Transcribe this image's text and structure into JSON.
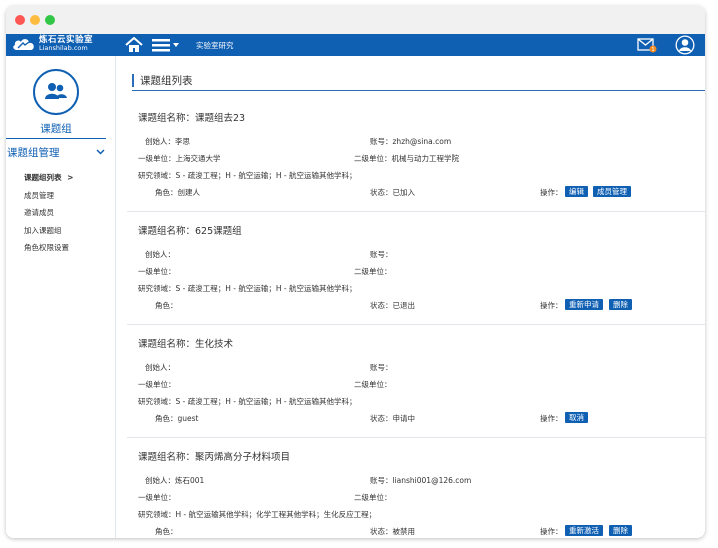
{
  "topbar": {
    "logo_cn": "炼石云实验室",
    "logo_en": "Lianshilab.com",
    "nav_lab": "实验室研究",
    "mail_badge": "1"
  },
  "sidebar": {
    "title": "课题组",
    "group": "课题组管理",
    "items": [
      {
        "label": "课题组列表",
        "arrow": ">"
      },
      {
        "label": "成员管理"
      },
      {
        "label": "邀请成员"
      },
      {
        "label": "加入课题组"
      },
      {
        "label": "角色权限设置"
      }
    ]
  },
  "page": {
    "title": "课题组列表"
  },
  "labels": {
    "op_label": "操作："
  },
  "groups": [
    {
      "name": "课题组名称：课题组去23",
      "creator": "创始人：李思",
      "account": "账号：zhzh@sina.com",
      "unit1": "一级单位：上海交通大学",
      "unit2": "二级单位：机械与动力工程学院",
      "field": "研究领域：S - 疏浚工程；H - 航空运输；H - 航空运输其他学科；",
      "role": "角色：创建人",
      "status": "状态：已加入",
      "buttons": [
        "编辑",
        "成员管理"
      ]
    },
    {
      "name": "课题组名称：625课题组",
      "creator": "创始人：",
      "account": "账号：",
      "unit1": "一级单位：",
      "unit2": "二级单位：",
      "field": "研究领域：S - 疏浚工程；H - 航空运输；H - 航空运输其他学科；",
      "role": "角色：",
      "status": "状态：已退出",
      "buttons": [
        "重新申请",
        "删除"
      ]
    },
    {
      "name": "课题组名称：生化技术",
      "creator": "创始人：",
      "account": "账号：",
      "unit1": "一级单位：",
      "unit2": "二级单位：",
      "field": "研究领域：S - 疏浚工程；H - 航空运输；H - 航空运输其他学科；",
      "role": "角色：guest",
      "status": "状态：申请中",
      "buttons": [
        "取消"
      ]
    },
    {
      "name": "课题组名称：聚丙烯高分子材料项目",
      "creator": "创始人：炼石001",
      "account": "账号：lianshi001@126.com",
      "unit1": "一级单位：",
      "unit2": "二级单位：",
      "field": "研究领域：H - 航空运输其他学科；化学工程其他学科；生化反应工程；",
      "role": "角色：",
      "status": "状态：被禁用",
      "buttons": [
        "重新激活",
        "删除"
      ]
    }
  ],
  "colors": {
    "brand": "#0f5fb3",
    "accent_line": "#2b6db8"
  }
}
